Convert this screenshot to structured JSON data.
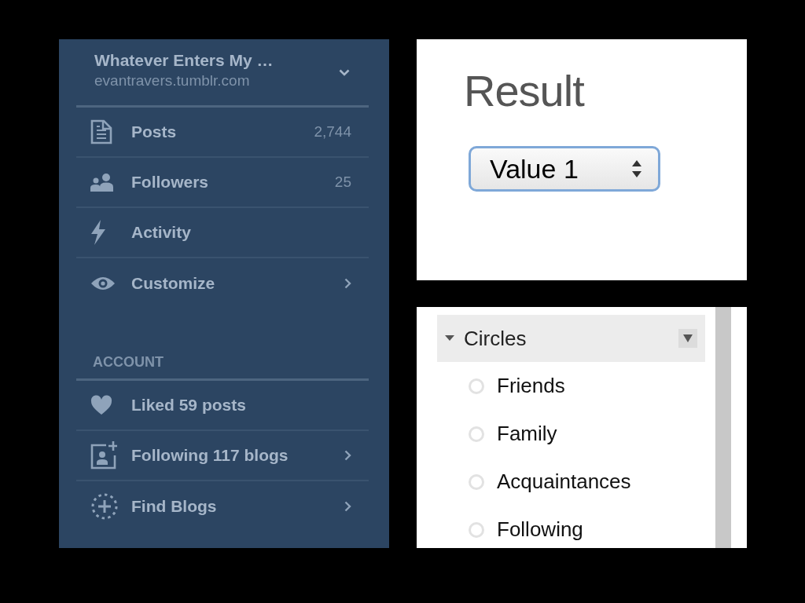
{
  "blog_menu": {
    "title": "Whatever Enters My …",
    "url": "evantravers.tumblr.com",
    "items": [
      {
        "kind": "posts",
        "label": "Posts",
        "count": "2,744",
        "arrow": false
      },
      {
        "kind": "followers",
        "label": "Followers",
        "count": "25",
        "arrow": false
      },
      {
        "kind": "activity",
        "label": "Activity",
        "arrow": false
      },
      {
        "kind": "customize",
        "label": "Customize",
        "arrow": true
      }
    ],
    "account_heading": "ACCOUNT",
    "account_items": [
      {
        "kind": "liked",
        "label": "Liked 59 posts",
        "arrow": false
      },
      {
        "kind": "following",
        "label": "Following 117 blogs",
        "arrow": true
      },
      {
        "kind": "find",
        "label": "Find Blogs",
        "arrow": true
      }
    ]
  },
  "result": {
    "title": "Result",
    "select_value": "Value 1"
  },
  "circles": {
    "label": "Circles",
    "expanded": true,
    "items": [
      {
        "label": "Friends",
        "selected": false
      },
      {
        "label": "Family",
        "selected": false
      },
      {
        "label": "Acquaintances",
        "selected": false
      },
      {
        "label": "Following",
        "selected": false
      }
    ]
  }
}
